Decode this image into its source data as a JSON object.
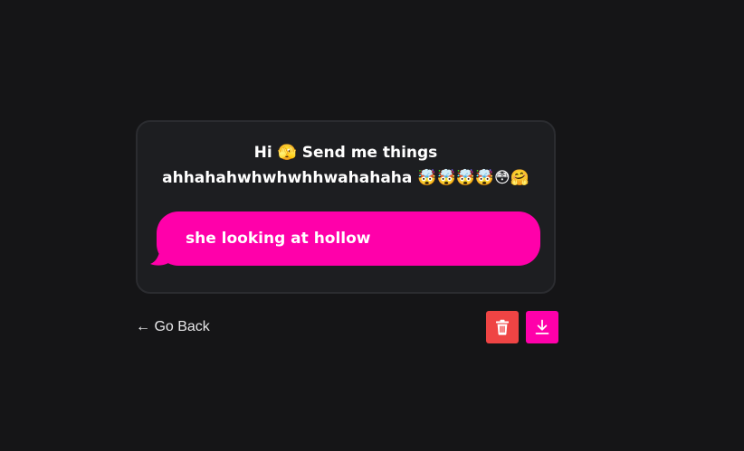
{
  "prompt": {
    "text": "Hi 🫣 Send me things ahhahahwhwhwhhwahahaha 🤯🤯🤯🤯😳🤗"
  },
  "message": {
    "text": "she looking at hollow"
  },
  "nav": {
    "back_label": "← Go Back"
  },
  "actions": {
    "delete_icon": "trash-icon",
    "download_icon": "download-icon"
  },
  "colors": {
    "background": "#151517",
    "card": "#1d1e21",
    "accent": "#ff00aa",
    "danger": "#ef4444"
  }
}
